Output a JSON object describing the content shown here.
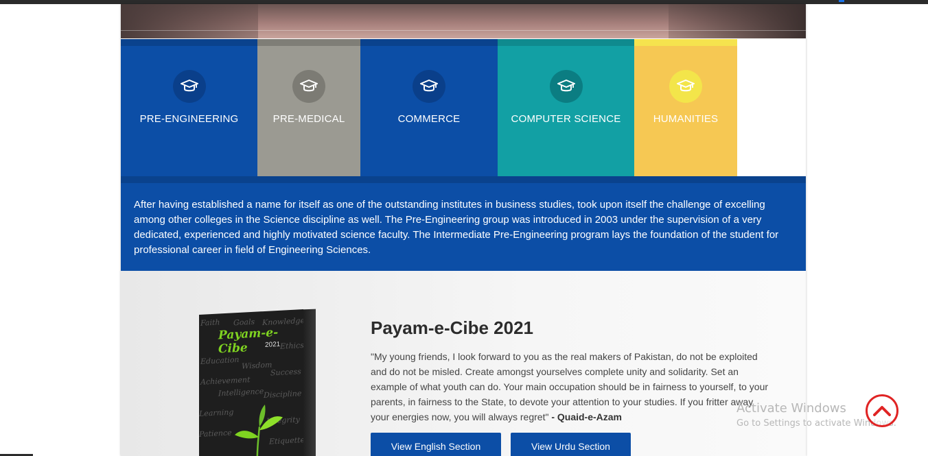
{
  "programs": [
    {
      "label": "PRE-ENGINEERING",
      "color": "#0c4ea6",
      "stripe": "#0a428d",
      "icon_bg": "#0a3f8a",
      "icon": "graduation-cap-icon"
    },
    {
      "label": "PRE-MEDICAL",
      "color": "#9b9a92",
      "stripe": "#7f7e77",
      "icon_bg": "#7c7b74",
      "icon": "graduation-cap-icon"
    },
    {
      "label": "COMMERCE",
      "color": "#0c4ea6",
      "stripe": "#0a428d",
      "icon_bg": "#0a3f8a",
      "icon": "graduation-cap-icon"
    },
    {
      "label": "COMPUTER SCIENCE",
      "color": "#12a0a4",
      "stripe": "#0f8a8e",
      "icon_bg": "#0b7d82",
      "icon": "graduation-cap-icon"
    },
    {
      "label": "HUMANITIES",
      "color": "#f6c853",
      "stripe": "#f5e34e",
      "icon_bg": "#f3e54a",
      "icon": "graduation-cap-icon"
    }
  ],
  "about": {
    "text": "After having established a name for itself as one of the outstanding institutes in business studies, took upon itself the challenge of excelling among other colleges in the Science discipline as well. The Pre-Engineering group was introduced in 2003 under the supervision of a very dedicated, experienced and highly motivated science faculty. The Intermediate Pre-Engineering program lays the foundation of the student for professional career in field of Engineering Sciences."
  },
  "magazine": {
    "heading": "Payam-e-Cibe 2021",
    "quote": "\"My young friends, I look forward to you as the real makers of Pakistan, do not be exploited and do not be misled. Create amongst yourselves complete unity and solidarity. Set an example of what youth can do. Your main occupation should be in fairness to yourself, to your parents, in fairness to the State, to devote your attention to your studies. If you fritter away your energies now, you will always regret\"",
    "author": "- Quaid-e-Azam",
    "cover_title": "Payam-e-Cibe",
    "cover_year": "2021",
    "cover_words": [
      "Faith",
      "Goals",
      "Knowledge",
      "Ethics",
      "Education",
      "Wisdom",
      "Success",
      "Achievement",
      "Intelligence",
      "Discipline",
      "Learning",
      "Integrity",
      "Patience",
      "Etiquettes"
    ],
    "buttons": {
      "english": "View English Section",
      "urdu": "View Urdu Section"
    }
  },
  "watermark": {
    "line1": "Activate Windows",
    "line2": "Go to Settings to activate Windows."
  },
  "colors": {
    "accent": "#0c4ea6",
    "scroll_top": "#e02424"
  }
}
